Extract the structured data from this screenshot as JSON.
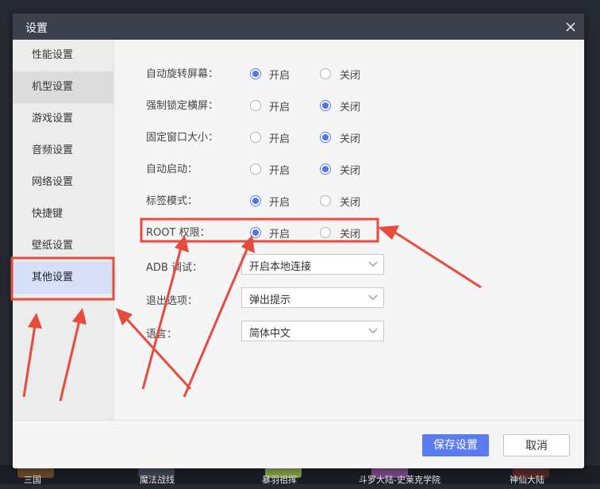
{
  "dialog": {
    "title": "设置"
  },
  "sidebar": {
    "items": [
      {
        "label": "性能设置"
      },
      {
        "label": "机型设置"
      },
      {
        "label": "游戏设置"
      },
      {
        "label": "音频设置"
      },
      {
        "label": "网络设置"
      },
      {
        "label": "快捷键"
      },
      {
        "label": "壁纸设置"
      },
      {
        "label": "其他设置"
      }
    ],
    "active": "其他设置"
  },
  "settings": {
    "on_label": "开启",
    "off_label": "关闭",
    "rows": [
      {
        "label": "自动旋转屏幕：",
        "value": "开启"
      },
      {
        "label": "强制锁定横屏：",
        "value": "关闭"
      },
      {
        "label": "固定窗口大小：",
        "value": "关闭"
      },
      {
        "label": "自动启动：",
        "value": "关闭"
      },
      {
        "label": "标签模式：",
        "value": "开启"
      },
      {
        "label": "ROOT 权限：",
        "value": "开启"
      }
    ],
    "selects": [
      {
        "label": "ADB 调试：",
        "value": "开启本地连接"
      },
      {
        "label": "退出选项：",
        "value": "弹出提示"
      },
      {
        "label": "语言：",
        "value": "简体中文"
      }
    ]
  },
  "footer": {
    "save_label": "保存设置",
    "cancel_label": "取消"
  },
  "background": {
    "games": [
      "三国",
      "魔法战线",
      "暴羽祖挥",
      "斗罗大陆-史莱克学院",
      "神仙大陆"
    ]
  },
  "colors": {
    "accent": "#5b7cf0",
    "annotation": "#e84a3c",
    "titlebar": "#3b404c"
  }
}
